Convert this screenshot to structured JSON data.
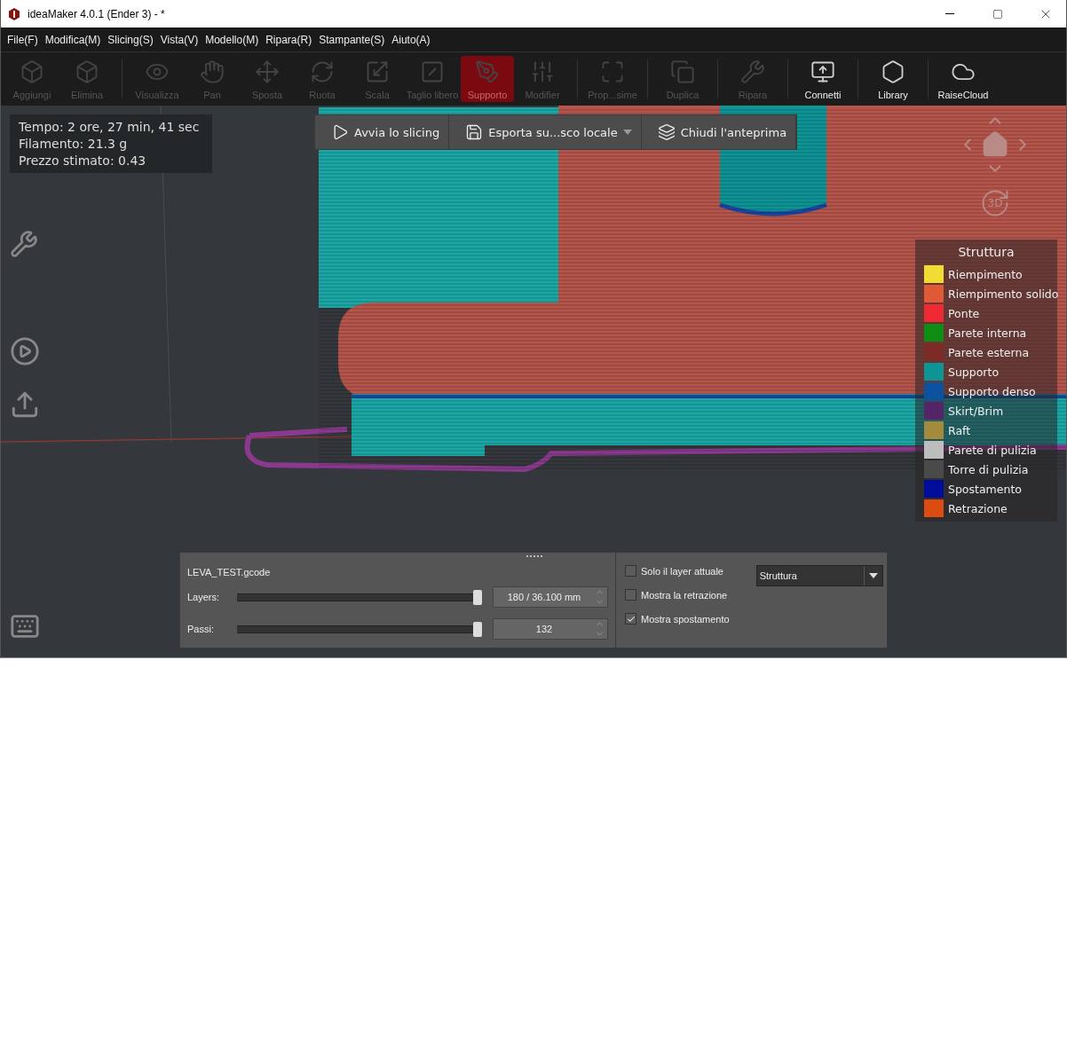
{
  "window": {
    "title": "ideaMaker 4.0.1 (Ender 3) - *"
  },
  "menu": [
    "File(F)",
    "Modifica(M)",
    "Slicing(S)",
    "Vista(V)",
    "Modello(M)",
    "Ripara(R)",
    "Stampante(S)",
    "Aiuto(A)"
  ],
  "toolbar": [
    {
      "label": "Aggiungi",
      "enabled": false,
      "selected": false,
      "divider_before": false
    },
    {
      "label": "Elimina",
      "enabled": false,
      "selected": false,
      "divider_before": false
    },
    {
      "label": "Visualizza",
      "enabled": false,
      "selected": false,
      "divider_before": true
    },
    {
      "label": "Pan",
      "enabled": false,
      "selected": false,
      "divider_before": false
    },
    {
      "label": "Sposta",
      "enabled": false,
      "selected": false,
      "divider_before": false
    },
    {
      "label": "Ruota",
      "enabled": false,
      "selected": false,
      "divider_before": false
    },
    {
      "label": "Scala",
      "enabled": false,
      "selected": false,
      "divider_before": false
    },
    {
      "label": "Taglio libero",
      "enabled": false,
      "selected": false,
      "divider_before": false
    },
    {
      "label": "Supporto",
      "enabled": false,
      "selected": true,
      "divider_before": false
    },
    {
      "label": "Modifier",
      "enabled": false,
      "selected": false,
      "divider_before": false
    },
    {
      "label": "Prop...sime",
      "enabled": false,
      "selected": false,
      "divider_before": true
    },
    {
      "label": "Duplica",
      "enabled": false,
      "selected": false,
      "divider_before": true
    },
    {
      "label": "Ripara",
      "enabled": false,
      "selected": false,
      "divider_before": true
    },
    {
      "label": "Connetti",
      "enabled": true,
      "selected": false,
      "divider_before": true
    },
    {
      "label": "Library",
      "enabled": true,
      "selected": false,
      "divider_before": true
    },
    {
      "label": "RaiseCloud",
      "enabled": true,
      "selected": false,
      "divider_before": true
    }
  ],
  "info": [
    "Tempo: 2 ore, 27 min, 41 sec",
    "Filamento: 21.3 g",
    "Prezzo stimato: 0.43"
  ],
  "actions": [
    {
      "label": "Avvia lo slicing",
      "kind": "play",
      "dropdown": false
    },
    {
      "label": "Esporta su...sco locale",
      "kind": "save",
      "dropdown": true
    },
    {
      "label": "Chiudi l'anteprima",
      "kind": "layers",
      "dropdown": false
    }
  ],
  "legend": {
    "title": "Struttura",
    "items": [
      {
        "label": "Riempimento",
        "color": "#f0dc32"
      },
      {
        "label": "Riempimento solido",
        "color": "#e05a37"
      },
      {
        "label": "Ponte",
        "color": "#ee2a35"
      },
      {
        "label": "Parete interna",
        "color": "#0f8c14"
      },
      {
        "label": "Parete esterna",
        "color": "#7d2b26"
      },
      {
        "label": "Supporto",
        "color": "#0f9496"
      },
      {
        "label": "Supporto denso",
        "color": "#0d52a0"
      },
      {
        "label": "Skirt/Brim",
        "color": "#542466"
      },
      {
        "label": "Raft",
        "color": "#a38a3c"
      },
      {
        "label": "Parete di pulizia",
        "color": "#bdbdbd"
      },
      {
        "label": "Torre di pulizia",
        "color": "#4a4a4a"
      },
      {
        "label": "Spostamento",
        "color": "#000c9a"
      },
      {
        "label": "Retrazione",
        "color": "#dc4c12"
      }
    ]
  },
  "nav": {
    "view_label": "3D"
  },
  "panel": {
    "file": "LEVA_TEST.gcode",
    "sliders": [
      {
        "label": "Layers:",
        "level": 1.0,
        "value": "180 / 36.100 mm"
      },
      {
        "label": "Passi:",
        "level": 1.0,
        "value": "132"
      }
    ],
    "options": [
      {
        "label": "Solo il layer attuale",
        "checked": false
      },
      {
        "label": "Mostra la retrazione",
        "checked": false
      },
      {
        "label": "Mostra spostamento",
        "checked": true
      }
    ],
    "view_select": {
      "value": "Struttura"
    }
  }
}
